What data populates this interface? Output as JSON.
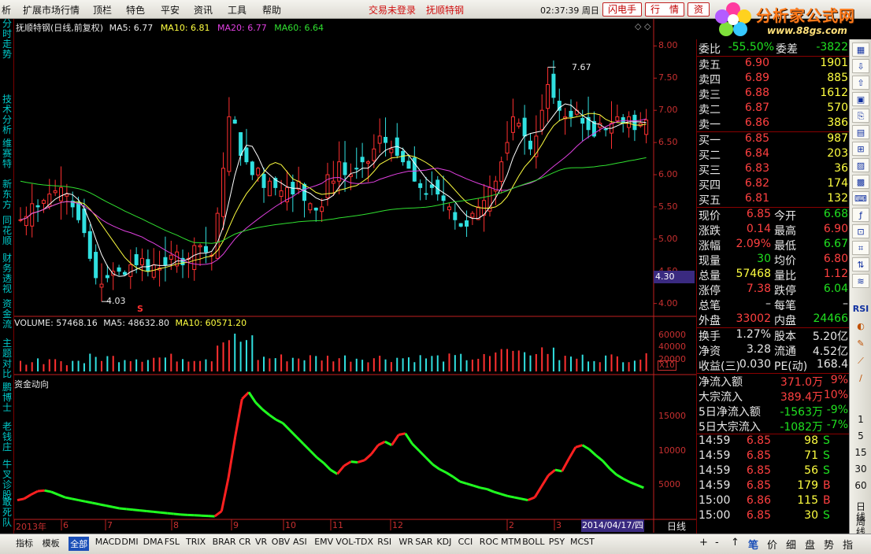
{
  "menu": {
    "items": [
      "析",
      "扩展市场行情",
      "顶栏",
      "特色",
      "平安",
      "资讯",
      "工具",
      "帮助"
    ],
    "status_not_logged_in": "交易未登录",
    "stock_name_top": "抚顺特钢",
    "clock": "02:37:39 周日",
    "btn_flash": "闪电手",
    "btn_quote": "行　情",
    "btn_info": "资"
  },
  "logo": {
    "title": "分析家公式网",
    "url": "www.88gs.com"
  },
  "left_tabs": [
    "分时走势",
    "技术分析",
    "维赛特",
    "新东方",
    "同花顺",
    "财务透视",
    "资金流",
    "主题对比",
    "鹏博士",
    "老钱庄",
    "牛叉诊股",
    "敢死队"
  ],
  "main_panel": {
    "title": "抚顺特钢(日线,前复权)",
    "ma5": "MA5: 6.77",
    "ma10": "MA10: 6.81",
    "ma20": "MA20: 6.77",
    "ma60": "MA60: 6.64",
    "y_ticks": [
      "8.00",
      "7.50",
      "7.00",
      "6.50",
      "6.00",
      "5.50",
      "5.00",
      "4.50",
      "4.00"
    ],
    "high_label": "7.67",
    "low_label": "4.03",
    "cursor_price": "4.30",
    "s_marker": "S"
  },
  "volume_panel": {
    "title": "VOLUME: 57468.16",
    "ma5": "MA5: 48632.80",
    "ma10": "MA10: 60571.20",
    "y_ticks": [
      "60000",
      "40000",
      "20000"
    ],
    "unit": "X10"
  },
  "fund_panel": {
    "title": "资金动向",
    "y_ticks": [
      "15000",
      "10000",
      "5000"
    ]
  },
  "x_axis": {
    "labels": [
      "2013年",
      "6",
      "7",
      "8",
      "9",
      "10",
      "11",
      "12",
      "2",
      "3"
    ],
    "cursor_date": "2014/04/17/四",
    "period": "日线"
  },
  "quote": {
    "weibi_label": "委比",
    "weibi": "-55.50%",
    "weicha_label": "委差",
    "weicha": "-3822",
    "sells": [
      {
        "label": "卖五",
        "price": "6.90",
        "vol": "1901"
      },
      {
        "label": "卖四",
        "price": "6.89",
        "vol": "885"
      },
      {
        "label": "卖三",
        "price": "6.88",
        "vol": "1612"
      },
      {
        "label": "卖二",
        "price": "6.87",
        "vol": "570"
      },
      {
        "label": "卖一",
        "price": "6.86",
        "vol": "386"
      }
    ],
    "buys": [
      {
        "label": "买一",
        "price": "6.85",
        "vol": "987"
      },
      {
        "label": "买二",
        "price": "6.84",
        "vol": "203"
      },
      {
        "label": "买三",
        "price": "6.83",
        "vol": "36"
      },
      {
        "label": "买四",
        "price": "6.82",
        "vol": "174"
      },
      {
        "label": "买五",
        "price": "6.81",
        "vol": "132"
      }
    ],
    "stats": [
      {
        "l1": "现价",
        "v1": "6.85",
        "c1": "red",
        "l2": "今开",
        "v2": "6.68",
        "c2": "green"
      },
      {
        "l1": "涨跌",
        "v1": "0.14",
        "c1": "red",
        "l2": "最高",
        "v2": "6.90",
        "c2": "red"
      },
      {
        "l1": "涨幅",
        "v1": "2.09%",
        "c1": "red",
        "l2": "最低",
        "v2": "6.67",
        "c2": "green"
      },
      {
        "l1": "现量",
        "v1": "30",
        "c1": "green",
        "l2": "均价",
        "v2": "6.80",
        "c2": "red"
      },
      {
        "l1": "总量",
        "v1": "57468",
        "c1": "yellow",
        "l2": "量比",
        "v2": "1.12",
        "c2": "red"
      },
      {
        "l1": "涨停",
        "v1": "7.38",
        "c1": "red",
        "l2": "跌停",
        "v2": "6.04",
        "c2": "green"
      },
      {
        "l1": "总笔",
        "v1": "–",
        "c1": "white",
        "l2": "每笔",
        "v2": "–",
        "c2": "white"
      },
      {
        "l1": "外盘",
        "v1": "33002",
        "c1": "red",
        "l2": "内盘",
        "v2": "24466",
        "c2": "green"
      }
    ],
    "stats2": [
      {
        "l1": "换手",
        "v1": "1.27%",
        "c1": "white",
        "l2": "股本",
        "v2": "5.20亿",
        "c2": "white"
      },
      {
        "l1": "净资",
        "v1": "3.28",
        "c1": "white",
        "l2": "流通",
        "v2": "4.52亿",
        "c2": "white"
      },
      {
        "l1": "收益(三)",
        "v1": "0.030",
        "c1": "white",
        "l2": "PE(动)",
        "v2": "168.4",
        "c2": "white"
      }
    ],
    "flows": [
      {
        "label": "净流入额",
        "value": "371.0万",
        "pct": "9%",
        "c": "red"
      },
      {
        "label": "大宗流入",
        "value": "389.4万",
        "pct": "10%",
        "c": "red"
      },
      {
        "label": "5日净流入额",
        "value": "-1563万",
        "pct": "-9%",
        "c": "green"
      },
      {
        "label": "5日大宗流入",
        "value": "-1082万",
        "pct": "-7%",
        "c": "green"
      }
    ],
    "ticks": [
      {
        "time": "14:59",
        "price": "6.85",
        "vol": "98",
        "side": "S"
      },
      {
        "time": "14:59",
        "price": "6.85",
        "vol": "71",
        "side": "S"
      },
      {
        "time": "14:59",
        "price": "6.85",
        "vol": "56",
        "side": "S"
      },
      {
        "time": "14:59",
        "price": "6.85",
        "vol": "179",
        "side": "B"
      },
      {
        "time": "15:00",
        "price": "6.86",
        "vol": "115",
        "side": "B"
      },
      {
        "time": "15:00",
        "price": "6.85",
        "vol": "30",
        "side": "S"
      }
    ]
  },
  "right_toolbar": {
    "labels": [
      "RSI"
    ],
    "periods": [
      "1",
      "5",
      "15",
      "30",
      "60"
    ],
    "bottom": [
      "日线",
      "周线"
    ]
  },
  "indicator_bar": {
    "tabs": [
      "指标",
      "模板",
      "全部",
      "MACD",
      "DMI",
      "DMA",
      "FSL",
      "TRIX",
      "BRAR",
      "CR",
      "VR",
      "OBV",
      "ASI",
      "EMV",
      "VOL-TDX",
      "RSI",
      "WR",
      "SAR",
      "KDJ",
      "CCI",
      "ROC",
      "MTM",
      "BOLL",
      "PSY",
      "MCST"
    ],
    "active": "全部"
  },
  "bottom_right_tabs": [
    "+",
    "-",
    "↑",
    "笔",
    "价",
    "细",
    "盘",
    "势",
    "指",
    "值",
    "筹"
  ],
  "colors": {
    "up": "#ff3030",
    "down": "#30e0e0",
    "ma5": "#ffffff",
    "ma10": "#ffff40",
    "ma20": "#e040e0",
    "ma60": "#30e030",
    "axis": "#c02020"
  },
  "chart_data": [
    {
      "type": "candlestick",
      "title": "抚顺特钢(日线,前复权)",
      "ylim": [
        3.8,
        8.2
      ],
      "series": [
        {
          "name": "MA5",
          "value": 6.77
        },
        {
          "name": "MA10",
          "value": 6.81
        },
        {
          "name": "MA20",
          "value": 6.77
        },
        {
          "name": "MA60",
          "value": 6.64
        }
      ],
      "closes": [
        5.3,
        5.35,
        5.55,
        5.5,
        5.6,
        5.7,
        5.75,
        5.8,
        5.7,
        5.5,
        5.3,
        5.1,
        4.7,
        4.4,
        4.3,
        4.4,
        4.5,
        4.5,
        4.45,
        4.6,
        4.6,
        4.7,
        4.5,
        4.6,
        4.55,
        4.6,
        4.75,
        4.8,
        4.6,
        4.7,
        4.9,
        4.9,
        4.8,
        4.75,
        5.4,
        6.1,
        6.9,
        6.8,
        6.3,
        6.2,
        6.0,
        6.1,
        5.8,
        5.9,
        5.8,
        5.75,
        5.8,
        5.7,
        5.9,
        5.6,
        5.55,
        5.45,
        5.5,
        6.0,
        5.9,
        6.2,
        6.0,
        6.0,
        6.1,
        6.2,
        6.2,
        6.4,
        6.6,
        6.5,
        6.4,
        6.3,
        6.2,
        6.1,
        5.9,
        5.8,
        5.7,
        5.8,
        5.7,
        5.6,
        5.5,
        5.3,
        5.2,
        5.2,
        5.4,
        5.5,
        5.6,
        5.8,
        5.9,
        6.2,
        6.5,
        6.9,
        6.8,
        6.6,
        6.4,
        6.6,
        7.0,
        7.4,
        7.2,
        7.0,
        6.9,
        6.9,
        7.0,
        6.8,
        6.7,
        6.6,
        6.8,
        6.7,
        6.8,
        6.9,
        6.8,
        6.9,
        6.7,
        6.8,
        6.85
      ],
      "high_label": 7.67,
      "low_label": 4.03
    },
    {
      "type": "bar",
      "title": "VOLUME",
      "ylim": [
        0,
        70000
      ],
      "values_summary": {
        "VOLUME": 57468.16,
        "MA5": 48632.8,
        "MA10": 60571.2
      }
    },
    {
      "type": "line",
      "title": "资金动向",
      "ylim": [
        0,
        19000
      ],
      "values": [
        2800,
        3000,
        3600,
        4100,
        4200,
        4000,
        3600,
        3200,
        3000,
        2800,
        2600,
        2400,
        2200,
        2000,
        1800,
        1600,
        1500,
        1400,
        1300,
        1200,
        1100,
        1000,
        900,
        800,
        700,
        650,
        600,
        550,
        500,
        450,
        1200,
        6000,
        12000,
        17500,
        18500,
        17000,
        16000,
        15200,
        14500,
        14000,
        13000,
        12000,
        11000,
        10000,
        9000,
        8200,
        7200,
        6600,
        7800,
        8400,
        8300,
        8600,
        9500,
        10800,
        11300,
        10800,
        12300,
        12500,
        11000,
        10000,
        9000,
        8000,
        7300,
        6800,
        6200,
        5500,
        5200,
        4900,
        4600,
        4400,
        4000,
        3700,
        3400,
        3200,
        3000,
        2800,
        3200,
        4800,
        6400,
        7200,
        7000,
        8800,
        10500,
        10800,
        10200,
        9300,
        8500,
        7400,
        6500,
        5900,
        5400,
        5000,
        4600
      ]
    }
  ]
}
